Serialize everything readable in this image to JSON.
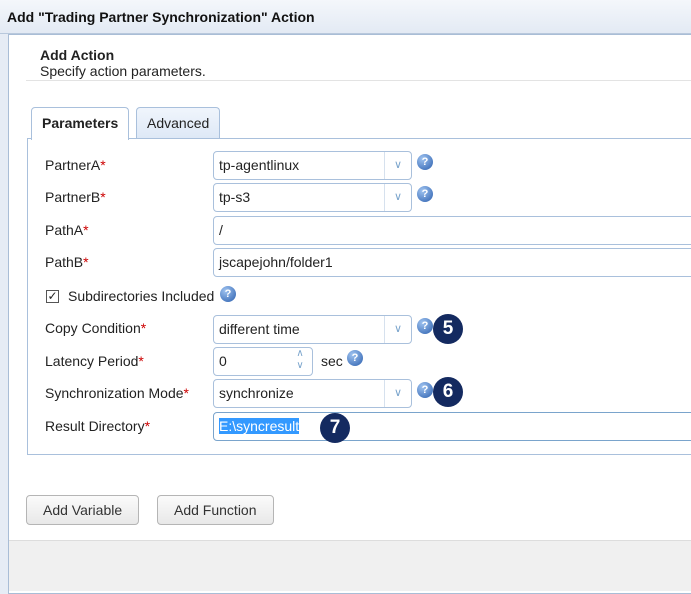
{
  "dialog_title": "Add \"Trading Partner Synchronization\" Action",
  "header": {
    "title": "Add Action",
    "subtitle": "Specify action parameters."
  },
  "tabs": [
    {
      "label": "Parameters",
      "active": true
    },
    {
      "label": "Advanced",
      "active": false
    }
  ],
  "fields": {
    "partnerA": {
      "label": "PartnerA",
      "value": "tp-agentlinux"
    },
    "partnerB": {
      "label": "PartnerB",
      "value": "tp-s3"
    },
    "pathA": {
      "label": "PathA",
      "value": "/"
    },
    "pathB": {
      "label": "PathB",
      "value": "jscapejohn/folder1"
    },
    "subdirs": {
      "label": "Subdirectories Included",
      "checked": true
    },
    "copyCondition": {
      "label": "Copy Condition",
      "value": "different time"
    },
    "latency": {
      "label": "Latency Period",
      "value": "0",
      "unit": "sec"
    },
    "syncMode": {
      "label": "Synchronization Mode",
      "value": "synchronize"
    },
    "resultDir": {
      "label": "Result Directory",
      "value": "E:\\syncresult"
    }
  },
  "required_mark": "*",
  "help_glyph": "?",
  "badges": [
    "5",
    "6",
    "7"
  ],
  "buttons": {
    "add_variable": "Add Variable",
    "add_function": "Add Function"
  }
}
